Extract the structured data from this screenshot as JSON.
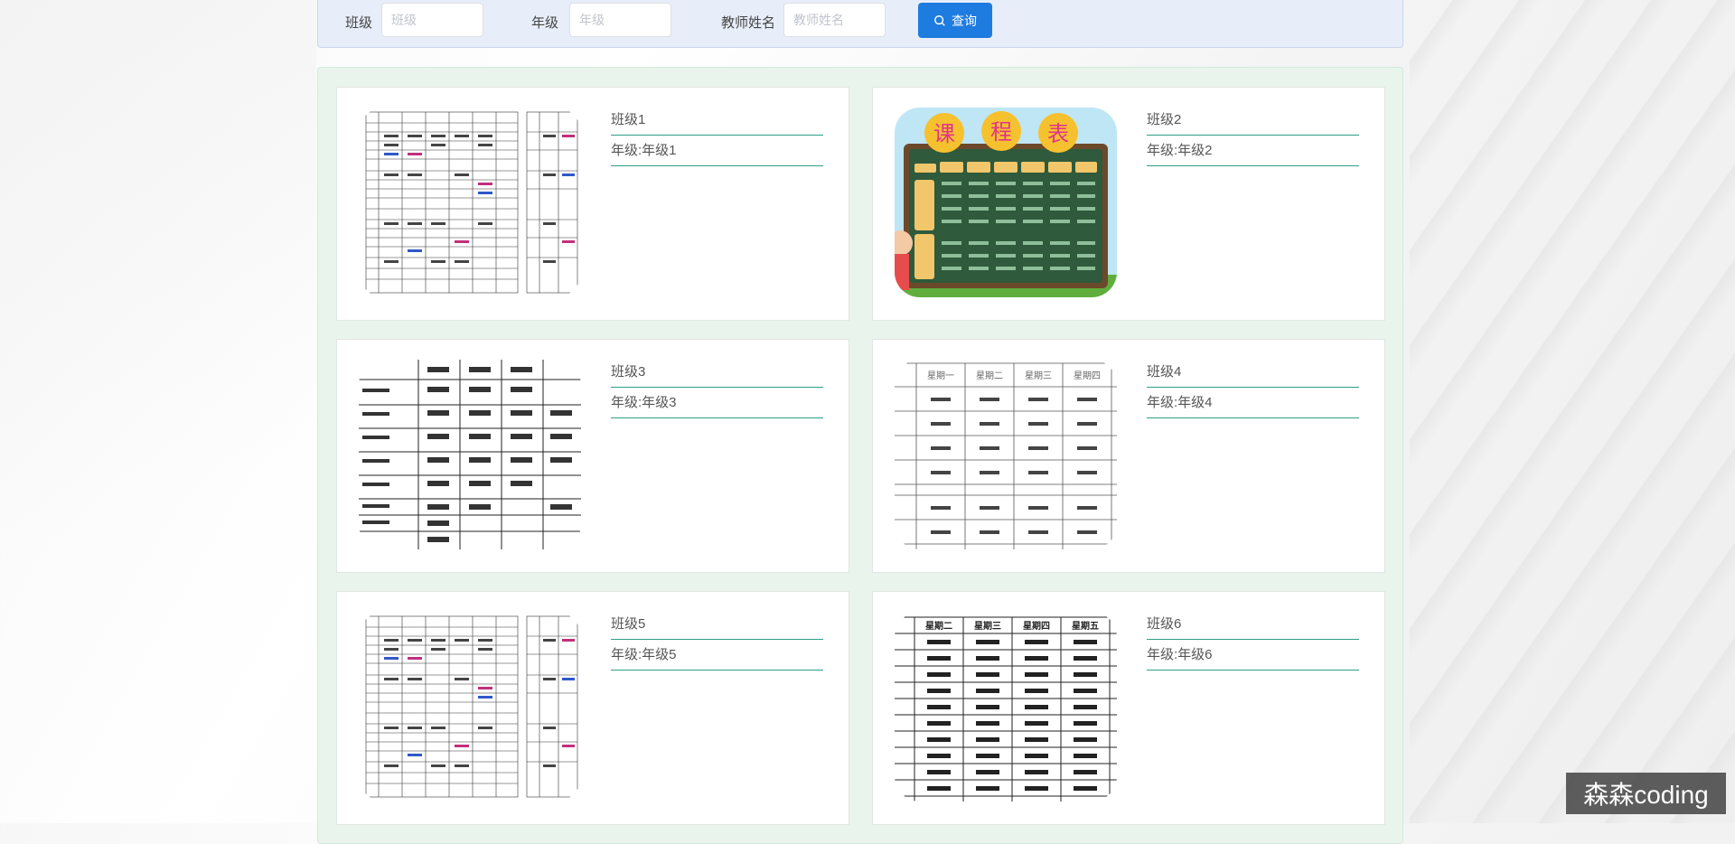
{
  "search": {
    "class_label": "班级",
    "class_placeholder": "班级",
    "grade_label": "年级",
    "grade_placeholder": "年级",
    "teacher_label": "教师姓名",
    "teacher_placeholder": "教师姓名",
    "button_label": "查询",
    "button_icon": "search-icon",
    "button_color": "#1e7be0"
  },
  "cards": [
    {
      "class_name": "班级1",
      "grade_text": "年级:年级1",
      "image": "timetable-grid-color"
    },
    {
      "class_name": "班级2",
      "grade_text": "年级:年级2",
      "image": "timetable-cartoon-blackboard",
      "image_title": [
        "课",
        "程",
        "表"
      ]
    },
    {
      "class_name": "班级3",
      "grade_text": "年级:年级3",
      "image": "timetable-handwritten"
    },
    {
      "class_name": "班级4",
      "grade_text": "年级:年级4",
      "image": "timetable-weekday-grid",
      "image_headers": [
        "星期一",
        "星期二",
        "星期三",
        "星期四"
      ]
    },
    {
      "class_name": "班级5",
      "grade_text": "年级:年级5",
      "image": "timetable-grid-color"
    },
    {
      "class_name": "班级6",
      "grade_text": "年级:年级6",
      "image": "timetable-teacher-grid",
      "image_headers": [
        "星期二",
        "星期三",
        "星期四",
        "星期五"
      ]
    }
  ],
  "watermark": "森森coding",
  "colors": {
    "accent_line": "#2e9f86",
    "panel_bg": "#e9f5ec",
    "search_bg": "#e7eef9"
  }
}
